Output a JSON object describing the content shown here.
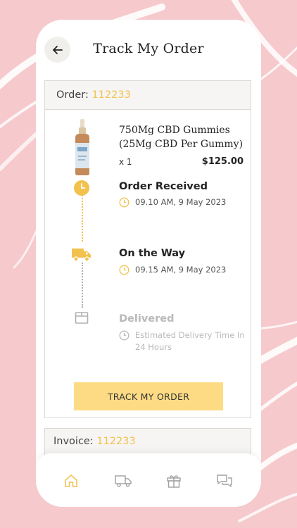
{
  "colors": {
    "accent": "#f2c14e",
    "button": "#fddb85",
    "background": "#f6c9cc",
    "muted": "#b9b9b9"
  },
  "header": {
    "title": "Track My Order",
    "back_icon": "arrow-left-icon"
  },
  "order": {
    "label": "Order:",
    "number": "112233"
  },
  "product": {
    "name": "750Mg CBD Gummies (25Mg CBD Per Gummy)",
    "quantity": "x 1",
    "price": "$125.00",
    "image_icon": "cbd-bottle-icon"
  },
  "timeline": [
    {
      "title": "Order Received",
      "time": "09.10 AM, 9 May 2023",
      "icon": "clock-icon",
      "completed": true
    },
    {
      "title": "On the Way",
      "time": "09.15 AM, 9 May 2023",
      "icon": "delivery-truck-icon",
      "completed": true
    },
    {
      "title": "Delivered",
      "time": "Estimated Delivery Time In 24 Hours",
      "icon": "box-icon",
      "completed": false
    }
  ],
  "track_button": {
    "label": "TRACK MY ORDER"
  },
  "invoice": {
    "label": "Invoice:",
    "number": "112233"
  },
  "nav": [
    {
      "icon": "home-icon",
      "active": true
    },
    {
      "icon": "truck-icon",
      "active": false
    },
    {
      "icon": "gift-icon",
      "active": false
    },
    {
      "icon": "chat-icon",
      "active": false
    }
  ]
}
